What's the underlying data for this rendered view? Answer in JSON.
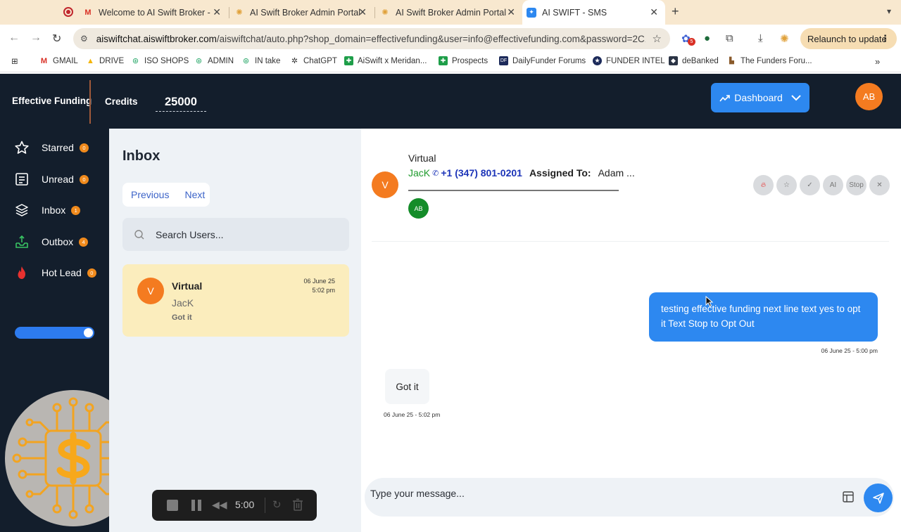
{
  "browser": {
    "tabs": [
      {
        "title": "Welcome to AI Swift Broker -"
      },
      {
        "title": "AI Swift Broker Admin Portal"
      },
      {
        "title": "AI Swift Broker Admin Portal"
      },
      {
        "title": "AI SWIFT - SMS"
      }
    ],
    "url_host": "aiswiftchat.aiswiftbroker.com",
    "url_path": "/aiswiftchat/auto.php?shop_domain=effectivefunding&user=info@effectivefunding.com&password=2C1...",
    "extension_badge": "5",
    "relaunch_label": "Relaunch to update",
    "bookmarks": [
      "GMAIL",
      "DRIVE",
      "ISO SHOPS",
      "ADMIN",
      "IN take",
      "ChatGPT",
      "AiSwift x Meridan...",
      "Prospects",
      "DailyFunder Forums",
      "FUNDER INTEL",
      "deBanked",
      "The Funders Foru..."
    ]
  },
  "header": {
    "brand": "Effective Funding",
    "credits_label": "Credits",
    "credits_value": "25000",
    "dashboard_label": "Dashboard",
    "avatar_initials": "AB"
  },
  "sidebar": {
    "items": [
      {
        "label": "Starred",
        "count": "0"
      },
      {
        "label": "Unread",
        "count": "0"
      },
      {
        "label": "Inbox",
        "count": "1"
      },
      {
        "label": "Outbox",
        "count": "4"
      },
      {
        "label": "Hot Lead",
        "count": "0"
      }
    ]
  },
  "inbox": {
    "title": "Inbox",
    "prev_label": "Previous",
    "next_label": "Next",
    "search_placeholder": "Search Users...",
    "conversations": [
      {
        "initial": "V",
        "name": "Virtual",
        "sub": "JacK",
        "last_message": "Got it",
        "date": "06 June 25",
        "time": "5:02 pm"
      }
    ]
  },
  "chat": {
    "initial": "V",
    "name": "Virtual",
    "sub": "JacK",
    "phone": "+1 (347) 801-0201",
    "assigned_label": "Assigned To:",
    "assignee": "Adam ...",
    "assignee_chip": "AB",
    "actions": {
      "stop_label": "Stop",
      "ai_label": "AI"
    },
    "messages": [
      {
        "direction": "out",
        "text": "testing effective funding next line text yes to opt it Text Stop to Opt Out",
        "time": "06 June 25 - 5:00 pm"
      },
      {
        "direction": "in",
        "text": "Got it",
        "time": "06 June 25 - 5:02 pm"
      }
    ],
    "compose_placeholder": "Type your message..."
  },
  "recorder": {
    "elapsed": "5:00"
  },
  "colors": {
    "accent_blue": "#2d88f0",
    "orange": "#f47b20",
    "dark_nav": "#131e2c",
    "card_highlight": "#fbedbd"
  }
}
